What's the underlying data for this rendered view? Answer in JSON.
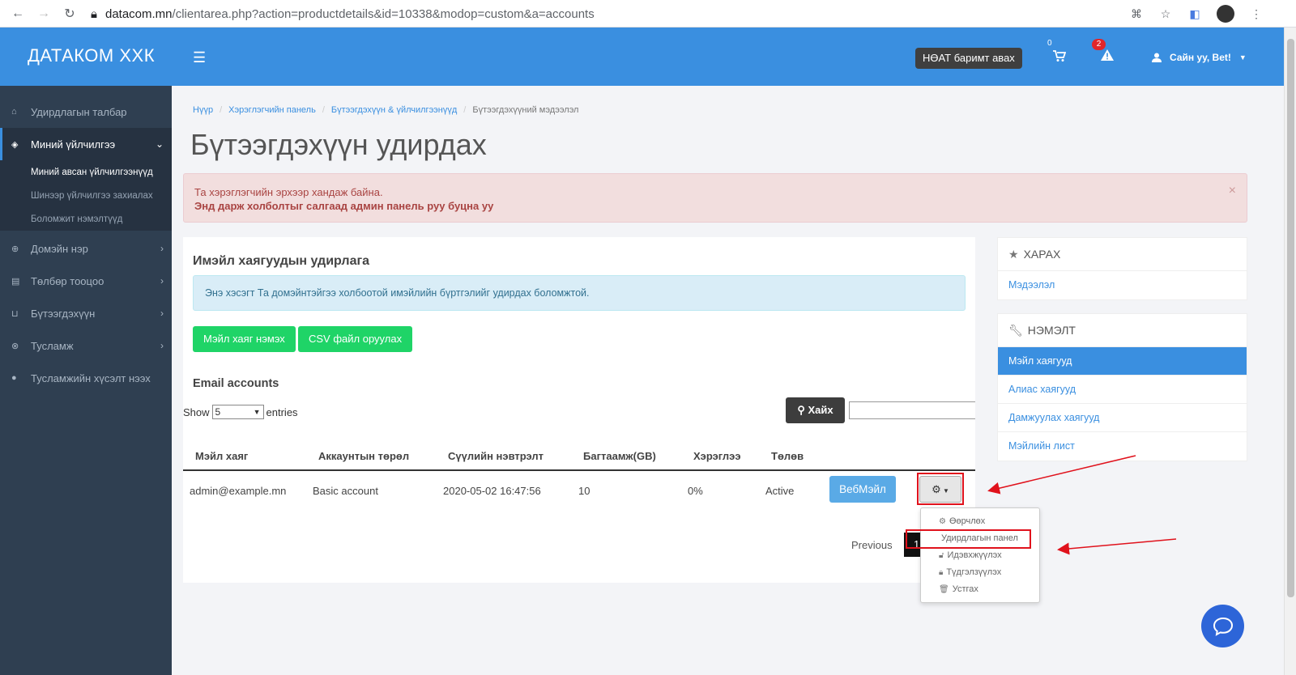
{
  "browser": {
    "url_host": "datacom.mn",
    "url_path": "/clientarea.php?action=productdetails&id=10338&modop=custom&a=accounts"
  },
  "header": {
    "brand": "ДАТАКОМ ХХК",
    "vat_button": "НӨАТ баримт авах",
    "cart_count": "0",
    "alert_count": "2",
    "user_greeting": "Сайн уу, Bet!"
  },
  "sidebar": {
    "items": [
      {
        "label": "Удирдлагын талбар",
        "icon": "dashboard-icon"
      },
      {
        "label": "Миний үйлчилгээ",
        "icon": "cube-icon"
      },
      {
        "label": "Домэйн нэр",
        "icon": "globe-icon"
      },
      {
        "label": "Төлбөр тооцоо",
        "icon": "invoice-icon"
      },
      {
        "label": "Бүтээгдэхүүн",
        "icon": "basket-icon"
      },
      {
        "label": "Тусламж",
        "icon": "lifebuoy-icon"
      },
      {
        "label": "Тусламжийн хүсэлт нээх",
        "icon": "comment-icon"
      }
    ],
    "subitems": [
      {
        "label": "Миний авсан үйлчилгээнүүд"
      },
      {
        "label": "Шинээр үйлчилгээ захиалах"
      },
      {
        "label": "Боломжит нэмэлтүүд"
      }
    ]
  },
  "breadcrumb": [
    "Нүүр",
    "Хэрэглэгчийн панель",
    "Бүтээгдэхүүн & үйлчилгээнүүд",
    "Бүтээгдэхүүний мэдээлэл"
  ],
  "page_title": "Бүтээгдэхүүн удирдах",
  "alert": {
    "line1": "Та хэрэглэгчийн эрхээр хандаж байна.",
    "line2": "Энд дарж холболтыг салгаад админ панель руу буцна уу",
    "close": "×"
  },
  "email_panel": {
    "title": "Имэйл хаягуудын удирлага",
    "info": "Энэ хэсэгт Та домэйнтэйгээ холбоотой имэйлийн бүртгэлийг удирдах боломжтой.",
    "add_button": "Мэйл хаяг нэмэх",
    "csv_button": "CSV файл оруулах",
    "accounts_title": "Email accounts",
    "show_label": "Show",
    "show_value": "5",
    "entries_label": "entries",
    "search_button": "Хайх",
    "columns": [
      "Мэйл хаяг",
      "Аккаунтын төрөл",
      "Сүүлийн нэвтрэлт",
      "Багтаамж(GB)",
      "Хэрэглээ",
      "Төлөв"
    ],
    "rows": [
      {
        "email": "admin@example.mn",
        "type": "Basic account",
        "last_login": "2020-05-02 16:47:56",
        "capacity": "10",
        "usage": "0%",
        "status": "Active"
      }
    ],
    "webmail_button": "ВебМэйл",
    "previous": "Previous",
    "page": "1"
  },
  "dropdown": {
    "items": [
      "Өөрчлөх",
      "Удирдлагын панел",
      "Идэвхжүүлэх",
      "Түдгэлзүүлэх",
      "Устгах"
    ]
  },
  "right_panels": {
    "view_title": "ХАРАХ",
    "view_items": [
      "Мэдээлэл"
    ],
    "addon_title": "НЭМЭЛТ",
    "addon_items": [
      "Мэйл хаягууд",
      "Алиас хаягууд",
      "Дамжуулах хаягууд",
      "Мэйлийн лист"
    ]
  },
  "colors": {
    "header_blue": "#3a8fe0",
    "sidebar_dark": "#2f3f51",
    "green_button": "#1fd467",
    "annotation_red": "#e0121c"
  }
}
